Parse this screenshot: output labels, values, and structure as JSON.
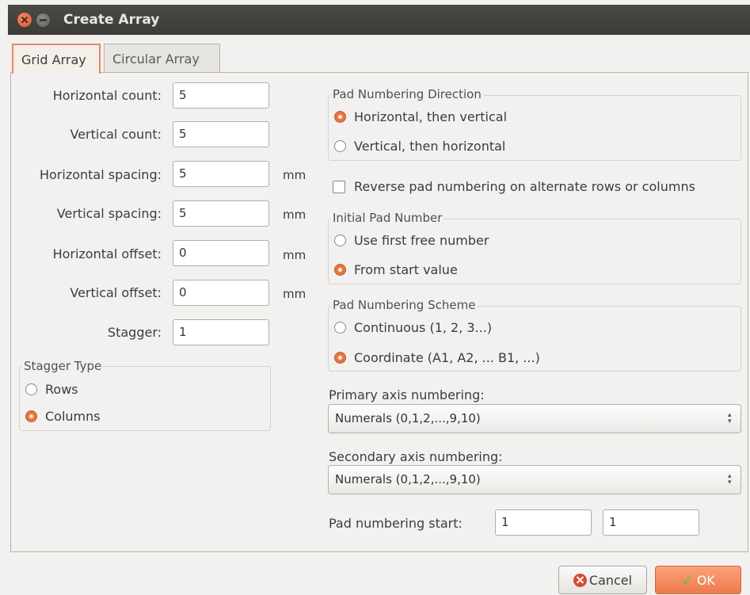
{
  "window": {
    "title": "Create Array"
  },
  "tabs": [
    {
      "label": "Grid Array"
    },
    {
      "label": "Circular Array"
    }
  ],
  "grid": {
    "horizontal_count": {
      "label": "Horizontal count:",
      "value": "5"
    },
    "vertical_count": {
      "label": "Vertical count:",
      "value": "5"
    },
    "horizontal_spacing": {
      "label": "Horizontal spacing:",
      "value": "5",
      "unit": "mm"
    },
    "vertical_spacing": {
      "label": "Vertical spacing:",
      "value": "5",
      "unit": "mm"
    },
    "horizontal_offset": {
      "label": "Horizontal offset:",
      "value": "0",
      "unit": "mm"
    },
    "vertical_offset": {
      "label": "Vertical offset:",
      "value": "0",
      "unit": "mm"
    },
    "stagger": {
      "label": "Stagger:",
      "value": "1"
    }
  },
  "stagger_type": {
    "title": "Stagger Type",
    "options": [
      {
        "label": "Rows",
        "selected": false
      },
      {
        "label": "Columns",
        "selected": true
      }
    ]
  },
  "pad_numbering_direction": {
    "title": "Pad Numbering Direction",
    "options": [
      {
        "label": "Horizontal, then vertical",
        "selected": true
      },
      {
        "label": "Vertical, then horizontal",
        "selected": false
      }
    ]
  },
  "reverse_numbering": {
    "label": "Reverse pad numbering on alternate rows or columns",
    "checked": false
  },
  "initial_pad_number": {
    "title": "Initial Pad Number",
    "options": [
      {
        "label": "Use first free number",
        "selected": false
      },
      {
        "label": "From start value",
        "selected": true
      }
    ]
  },
  "pad_numbering_scheme": {
    "title": "Pad Numbering Scheme",
    "options": [
      {
        "label": "Continuous (1, 2, 3...)",
        "selected": false
      },
      {
        "label": "Coordinate (A1, A2, ... B1, ...)",
        "selected": true
      }
    ]
  },
  "primary_axis": {
    "label": "Primary axis numbering:",
    "value": "Numerals (0,1,2,...,9,10)"
  },
  "secondary_axis": {
    "label": "Secondary axis numbering:",
    "value": "Numerals (0,1,2,...,9,10)"
  },
  "pad_numbering_start": {
    "label": "Pad numbering start:",
    "primary": "1",
    "secondary": "1"
  },
  "buttons": {
    "cancel": "Cancel",
    "ok": "OK"
  },
  "colors": {
    "accent": "#ee7a4c",
    "titlebar": "#3c3b37"
  }
}
